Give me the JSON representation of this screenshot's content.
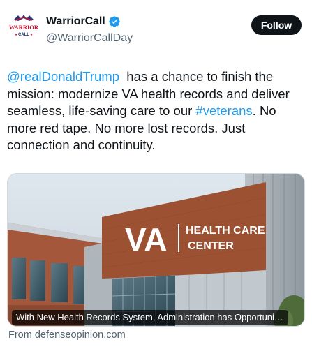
{
  "author": {
    "display_name": "WarriorCall",
    "handle": "@WarriorCallDay",
    "avatar_text_top": "WARRIOR",
    "avatar_text_bottom": "CALL"
  },
  "actions": {
    "follow_label": "Follow"
  },
  "tweet": {
    "mention": "@realDonaldTrump",
    "text_part1": "  has a chance to finish the mission: modernize VA health records and deliver seamless, life-saving care to our ",
    "hashtag": "#veterans",
    "text_part2": ". No more red tape. No more lost records. Just connection and continuity."
  },
  "card": {
    "sign_va": "VA",
    "sign_line1": "HEALTH CARE",
    "sign_line2": "CENTER",
    "caption": "With New Health Records System, Administration has Opportunit...",
    "source": "From defenseopinion.com"
  },
  "colors": {
    "link": "#1d9bf0",
    "text": "#0f1419",
    "secondary": "#536471",
    "brick": "#9c5232"
  },
  "icons": {
    "verified": "verified-badge-icon"
  }
}
